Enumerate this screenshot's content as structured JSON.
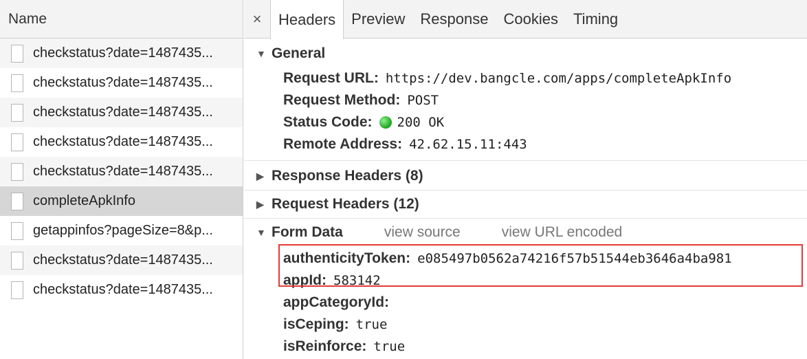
{
  "left_panel": {
    "header": "Name",
    "requests": [
      {
        "name": "checkstatus?date=1487435..."
      },
      {
        "name": "checkstatus?date=1487435..."
      },
      {
        "name": "checkstatus?date=1487435..."
      },
      {
        "name": "checkstatus?date=1487435..."
      },
      {
        "name": "checkstatus?date=1487435..."
      },
      {
        "name": "completeApkInfo"
      },
      {
        "name": "getappinfos?pageSize=8&p..."
      },
      {
        "name": "checkstatus?date=1487435..."
      },
      {
        "name": "checkstatus?date=1487435..."
      }
    ]
  },
  "tabs": {
    "close": "×",
    "items": [
      "Headers",
      "Preview",
      "Response",
      "Cookies",
      "Timing"
    ],
    "active": "Headers"
  },
  "general": {
    "title": "General",
    "request_url_label": "Request URL:",
    "request_url": "https://dev.bangcle.com/apps/completeApkInfo",
    "method_label": "Request Method:",
    "method": "POST",
    "status_label": "Status Code:",
    "status": "200 OK",
    "status_color": "#1ca31c",
    "remote_label": "Remote Address:",
    "remote": "42.62.15.11:443"
  },
  "response_headers": {
    "title": "Response Headers (8)"
  },
  "request_headers": {
    "title": "Request Headers (12)"
  },
  "form_data": {
    "title": "Form Data",
    "view_source": "view source",
    "view_url_encoded": "view URL encoded",
    "fields": [
      {
        "key": "authenticityToken:",
        "value": "e085497b0562a74216f57b51544eb3646a4ba981"
      },
      {
        "key": "appId:",
        "value": "583142"
      },
      {
        "key": "appCategoryId:",
        "value": ""
      },
      {
        "key": "isCeping:",
        "value": "true"
      },
      {
        "key": "isReinforce:",
        "value": "true"
      }
    ]
  },
  "colors": {
    "highlight": "#e53935",
    "selected_row": "#d6d6d6"
  }
}
